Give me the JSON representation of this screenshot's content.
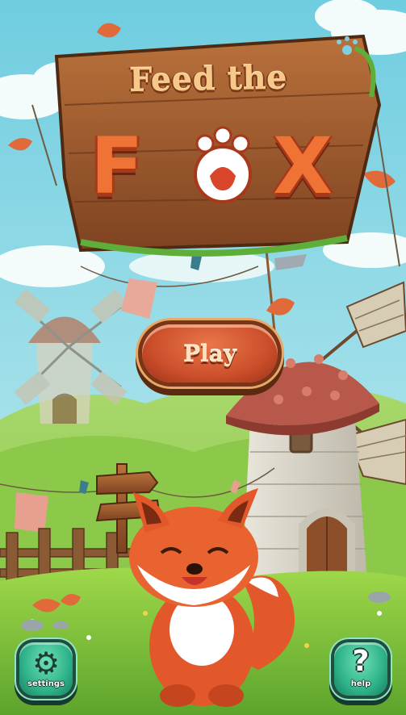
{
  "game": {
    "title_line1": "Feed the",
    "title_line2_letters": [
      "F",
      "X"
    ],
    "title_line2_hidden_letter": "O"
  },
  "menu": {
    "play_label": "Play"
  },
  "footer": {
    "settings_label": "settings",
    "help_label": "help",
    "settings_icon": "gear-icon",
    "help_icon": "question-icon",
    "help_glyph": "?"
  },
  "colors": {
    "sky": "#8fd7e6",
    "grass": "#8fcf45",
    "wood": "#9b5a2d",
    "title_orange": "#f07336",
    "play_button": "#cc4f2b",
    "corner_button": "#2fb38a",
    "fox": "#e2582a"
  }
}
